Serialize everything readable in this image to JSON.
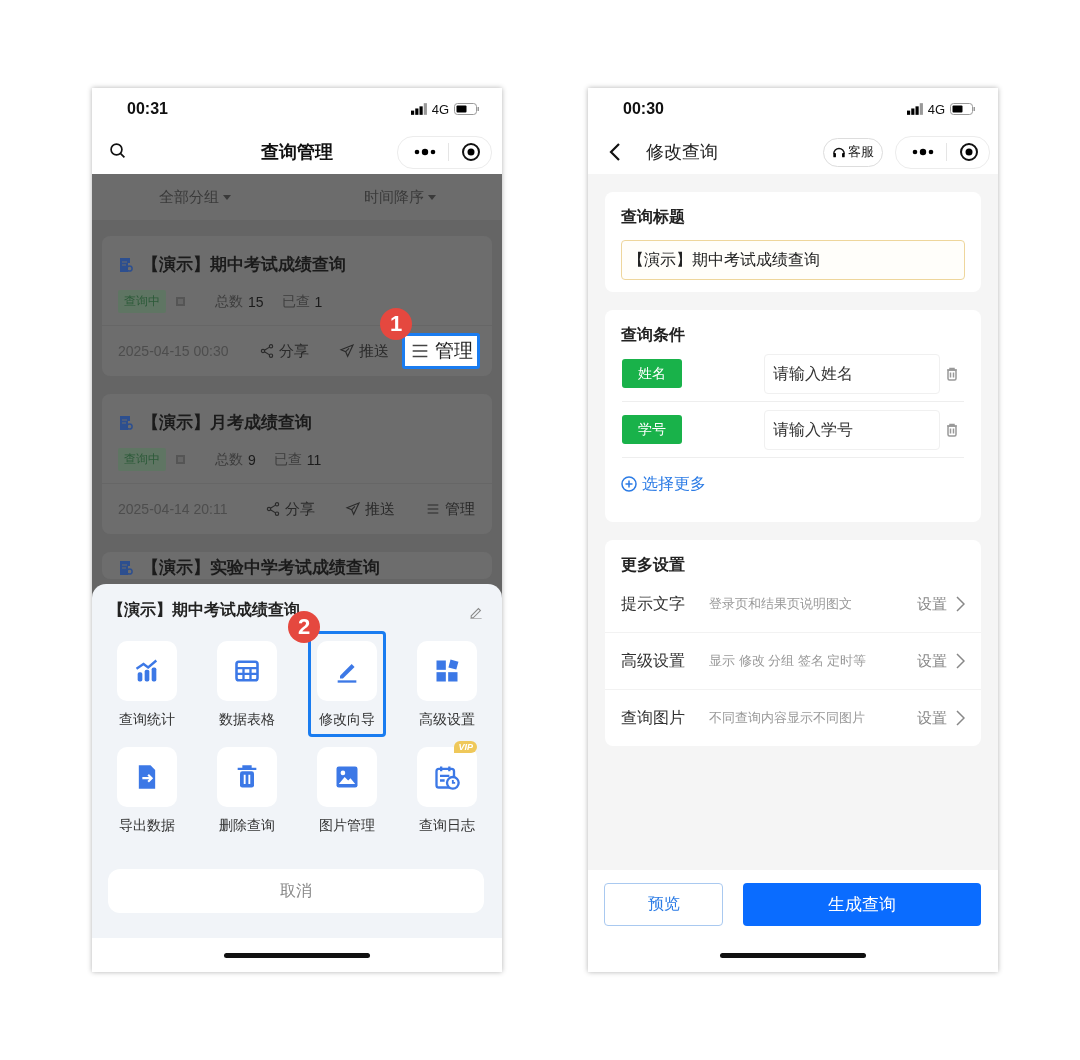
{
  "left_phone": {
    "status_bar": {
      "time": "00:31",
      "network": "4G"
    },
    "nav_bar": {
      "title": "查询管理"
    },
    "filters": [
      {
        "label": "全部分组"
      },
      {
        "label": "时间降序"
      }
    ],
    "queries": [
      {
        "title": "【演示】期中考试成绩查询",
        "status": "查询中",
        "total_label": "总数",
        "total": "15",
        "viewed_label": "已查",
        "viewed": "1",
        "date": "2025-04-15 00:30",
        "actions": [
          {
            "label": "分享",
            "highlighted": false
          },
          {
            "label": "推送",
            "highlighted": false
          },
          {
            "label": "管理",
            "highlighted": true,
            "step": "1"
          }
        ]
      },
      {
        "title": "【演示】月考成绩查询",
        "status": "查询中",
        "total_label": "总数",
        "total": "9",
        "viewed_label": "已查",
        "viewed": "11",
        "date": "2025-04-14 20:11",
        "actions": [
          {
            "label": "分享",
            "highlighted": false
          },
          {
            "label": "推送",
            "highlighted": false
          },
          {
            "label": "管理",
            "highlighted": false
          }
        ]
      },
      {
        "title": "【演示】实验中学考试成绩查询"
      }
    ],
    "action_sheet": {
      "title": "【演示】期中考试成绩查询",
      "actions": [
        {
          "label": "查询统计",
          "highlighted": false
        },
        {
          "label": "数据表格",
          "highlighted": false
        },
        {
          "label": "修改向导",
          "highlighted": true,
          "step": "2"
        },
        {
          "label": "高级设置",
          "highlighted": false
        },
        {
          "label": "导出数据",
          "highlighted": false
        },
        {
          "label": "删除查询",
          "highlighted": false
        },
        {
          "label": "图片管理",
          "highlighted": false
        },
        {
          "label": "查询日志",
          "highlighted": false,
          "badge": "VIP"
        }
      ],
      "cancel": "取消"
    }
  },
  "right_phone": {
    "status_bar": {
      "time": "00:30",
      "network": "4G"
    },
    "nav_bar": {
      "title": "修改查询",
      "service": "客服"
    },
    "title_section": {
      "heading": "查询标题",
      "value": "【演示】期中考试成绩查询"
    },
    "conditions": {
      "heading": "查询条件",
      "fields": [
        {
          "tag": "姓名",
          "placeholder": "请输入姓名"
        },
        {
          "tag": "学号",
          "placeholder": "请输入学号"
        }
      ],
      "add_more": "选择更多"
    },
    "more_settings": {
      "heading": "更多设置",
      "rows": [
        {
          "label": "提示文字",
          "description": "登录页和结果页说明图文",
          "action": "设置"
        },
        {
          "label": "高级设置",
          "description": "显示 修改 分组 签名 定时等",
          "action": "设置"
        },
        {
          "label": "查询图片",
          "description": "不同查询内容显示不同图片",
          "action": "设置"
        }
      ]
    },
    "footer": {
      "buttons": [
        {
          "label": "预览",
          "kind": "secondary"
        },
        {
          "label": "生成查询",
          "kind": "primary"
        }
      ]
    }
  }
}
